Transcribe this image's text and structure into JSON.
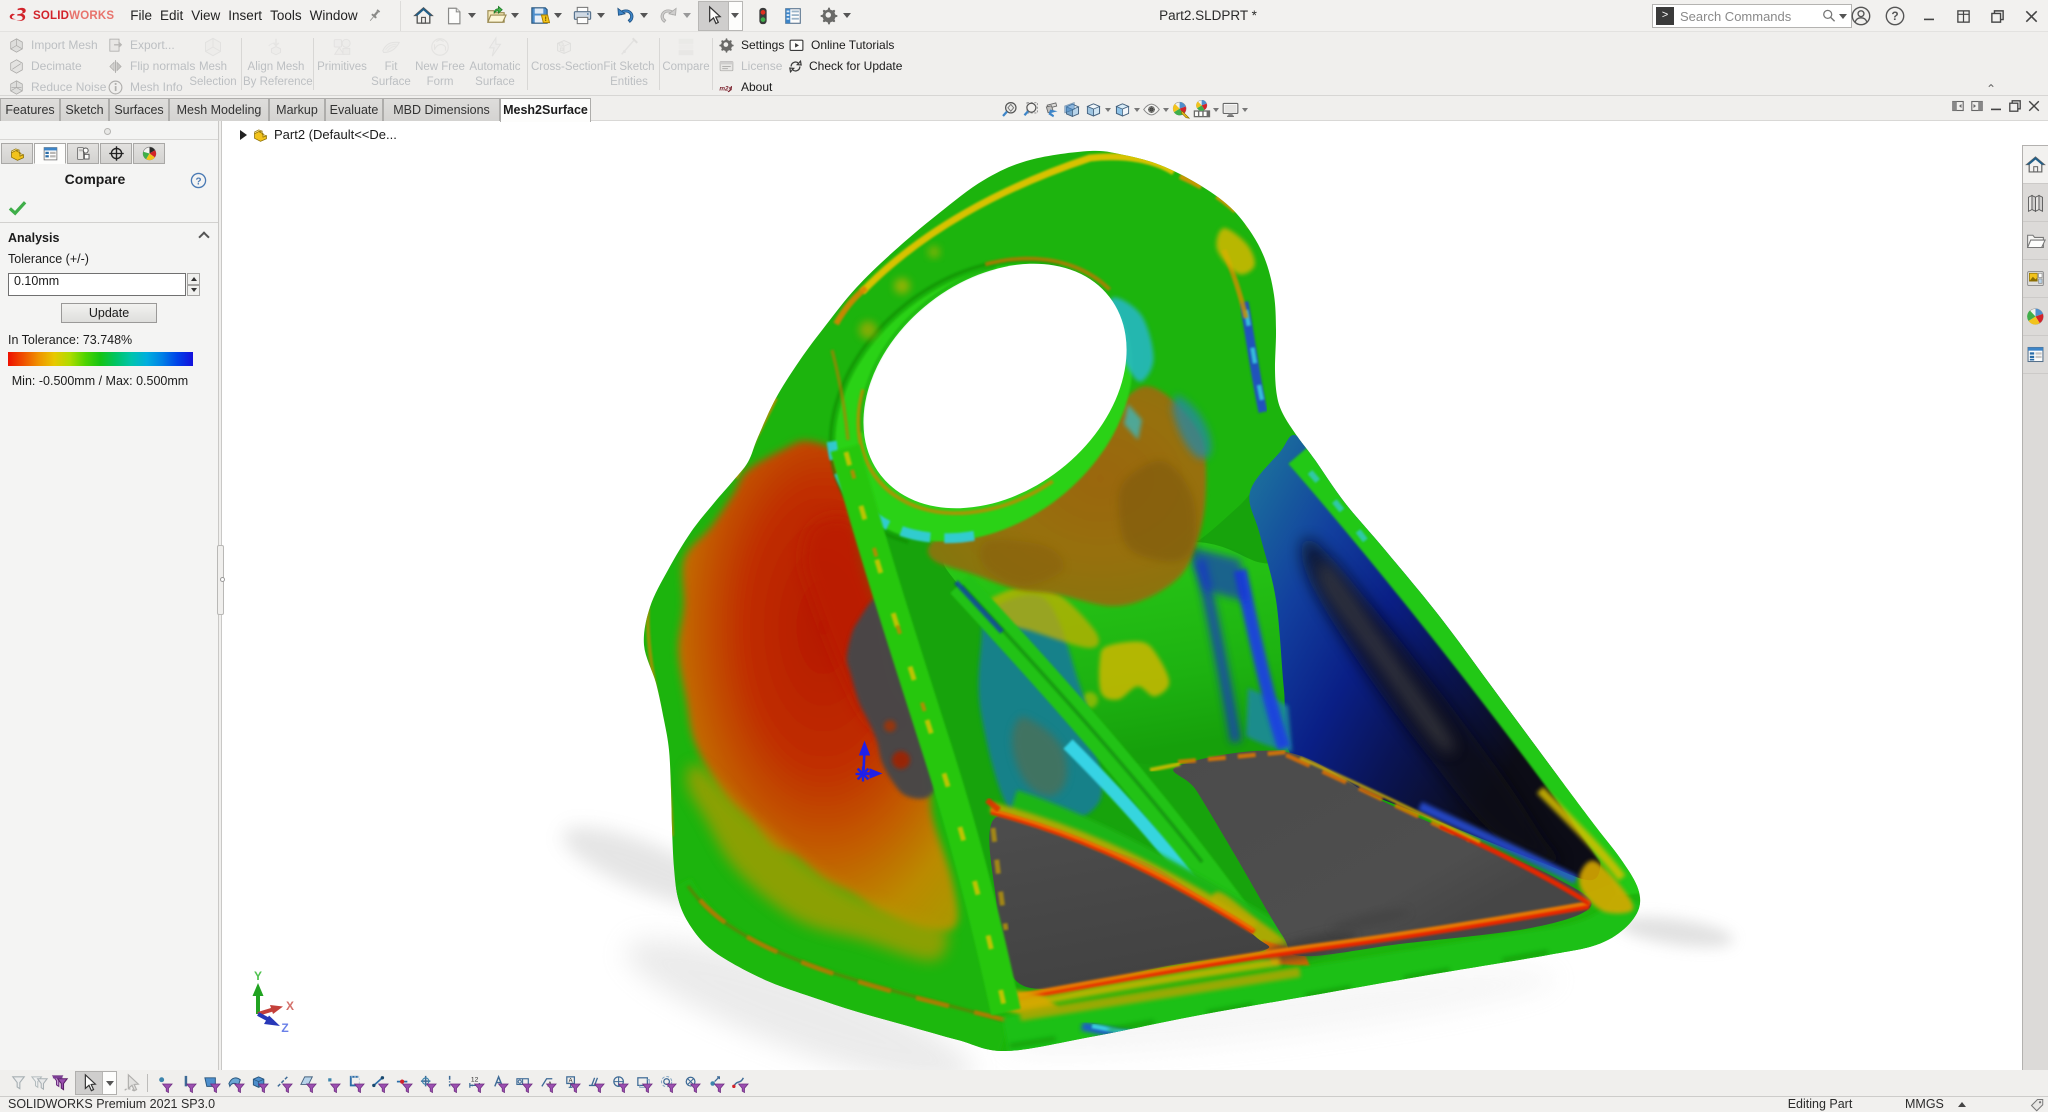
{
  "window": {
    "brand_solid": "SOLID",
    "brand_works": "WORKS",
    "title": "Part2.SLDPRT *",
    "menus": [
      "File",
      "Edit",
      "View",
      "Insert",
      "Tools",
      "Window"
    ],
    "search_placeholder": "Search Commands"
  },
  "quick_access": {
    "icons": [
      "home",
      "new-document",
      "open",
      "save",
      "print",
      "undo",
      "redo",
      "select-cursor",
      "rebuild-stoplight",
      "file-properties",
      "options-gear"
    ]
  },
  "ribbon": {
    "group_mesh_tools": {
      "import_mesh": "Import Mesh",
      "decimate": "Decimate",
      "reduce_noise": "Reduce Noise",
      "export": "Export...",
      "flip_normals": "Flip normals",
      "mesh_info": "Mesh Info",
      "mesh_selection_1": "Mesh",
      "mesh_selection_2": "Selection"
    },
    "align_1": "Align Mesh",
    "align_2": "By Reference",
    "primitives": "Primitives",
    "fit_surface_1": "Fit",
    "fit_surface_2": "Surface",
    "free_form_1": "New Free",
    "free_form_2": "Form",
    "auto_surface_1": "Automatic",
    "auto_surface_2": "Surface",
    "cross_section": "Cross-Section",
    "fit_sketch_1": "Fit Sketch",
    "fit_sketch_2": "Entities",
    "compare": "Compare",
    "settings": "Settings",
    "license": "License",
    "about": "About",
    "online_tutorials": "Online Tutorials",
    "check_update": "Check for Update"
  },
  "tabs": {
    "features": "Features",
    "sketch": "Sketch",
    "surfaces": "Surfaces",
    "mesh_modeling": "Mesh Modeling",
    "markup": "Markup",
    "evaluate": "Evaluate",
    "mbd_dimensions": "MBD Dimensions",
    "mesh2surface": "Mesh2Surface"
  },
  "property_manager": {
    "title": "Compare",
    "status_icon": "green-check",
    "analysis_header": "Analysis",
    "tolerance_label": "Tolerance (+/-)",
    "tolerance_value": "0.10mm",
    "update_button": "Update",
    "in_tolerance": "In Tolerance: 73.748%",
    "scale_minmax": "Min: -0.500mm / Max: 0.500mm",
    "gradient_colors": [
      "#ee1000",
      "#f05000",
      "#f09400",
      "#e8c800",
      "#b0dc00",
      "#50d400",
      "#14c414",
      "#00c464",
      "#00c4ac",
      "#00aede",
      "#0080e6",
      "#0042e8",
      "#1410dc"
    ]
  },
  "feature_tree": {
    "root": "Part2  (Default<<De..."
  },
  "viewport": {
    "hud_icons": [
      "zoom-to-fit",
      "zoom-to-area",
      "previous-view",
      "section-view",
      "view-orientation",
      "display-style",
      "hide-show-items",
      "edit-appearance",
      "apply-scene",
      "view-settings"
    ],
    "triad": {
      "x": "X",
      "y": "Y",
      "z": "Z"
    }
  },
  "task_pane": {
    "icons": [
      "home",
      "design-library",
      "file-explorer",
      "view-palette",
      "appearances-scenes",
      "custom-properties"
    ]
  },
  "filter_toolbar": {
    "lead_icons": [
      "toggle-selection-filters",
      "hide-all-filters",
      "clear-all-filters",
      "select-arrow",
      "lasso-select"
    ],
    "filters": [
      {
        "name": "filter-vertices",
        "glyph": "#g-vertex"
      },
      {
        "name": "filter-edges",
        "glyph": "#g-edge"
      },
      {
        "name": "filter-faces",
        "glyph": "#g-face"
      },
      {
        "name": "filter-surface-bodies",
        "glyph": "#g-surf"
      },
      {
        "name": "filter-solid-bodies",
        "glyph": "#g-solid"
      },
      {
        "name": "filter-axes",
        "glyph": "#g-axis"
      },
      {
        "name": "filter-planes",
        "glyph": "#g-plane"
      },
      {
        "name": "filter-points",
        "glyph": "#g-point"
      },
      {
        "name": "filter-sketches",
        "glyph": "#g-sketch"
      },
      {
        "name": "filter-sketch-segments",
        "glyph": "#g-seg"
      },
      {
        "name": "filter-midpoints",
        "glyph": "#g-mid"
      },
      {
        "name": "filter-center-marks",
        "glyph": "#g-cmark"
      },
      {
        "name": "filter-centerlines",
        "glyph": "#g-cline"
      },
      {
        "name": "filter-dimensions",
        "glyph": "#g-dim"
      },
      {
        "name": "filter-surface-finish",
        "glyph": "#g-sf"
      },
      {
        "name": "filter-geometric-tolerances",
        "glyph": "#g-gtol"
      },
      {
        "name": "filter-notes",
        "glyph": "#g-note"
      },
      {
        "name": "filter-datums",
        "glyph": "#g-datum"
      },
      {
        "name": "filter-weld-symbols",
        "glyph": "#g-weld"
      },
      {
        "name": "filter-datum-targets",
        "glyph": "#g-target"
      },
      {
        "name": "filter-blocks",
        "glyph": "#g-block"
      },
      {
        "name": "filter-cosmetic-threads",
        "glyph": "#g-thread"
      },
      {
        "name": "filter-dowel-pins",
        "glyph": "#g-dowel"
      },
      {
        "name": "filter-connection-points",
        "glyph": "#g-conn"
      },
      {
        "name": "filter-routing-points",
        "glyph": "#g-route"
      }
    ]
  },
  "status_bar": {
    "left": "SOLIDWORKS Premium 2021 SP3.0",
    "editing": "Editing Part",
    "units": "MMGS",
    "icons": [
      "unit-system-caret",
      "tag-icon"
    ]
  },
  "colors": {
    "brand_red": "#d2232a",
    "check_green": "#3fae49",
    "model_green": "#1cb40d",
    "model_red": "#c22000",
    "model_blue": "#0a1f86",
    "model_grey": "#4a4a4a",
    "disabled_text": "#b9bcbe",
    "accent_blue": "#2471b8"
  }
}
